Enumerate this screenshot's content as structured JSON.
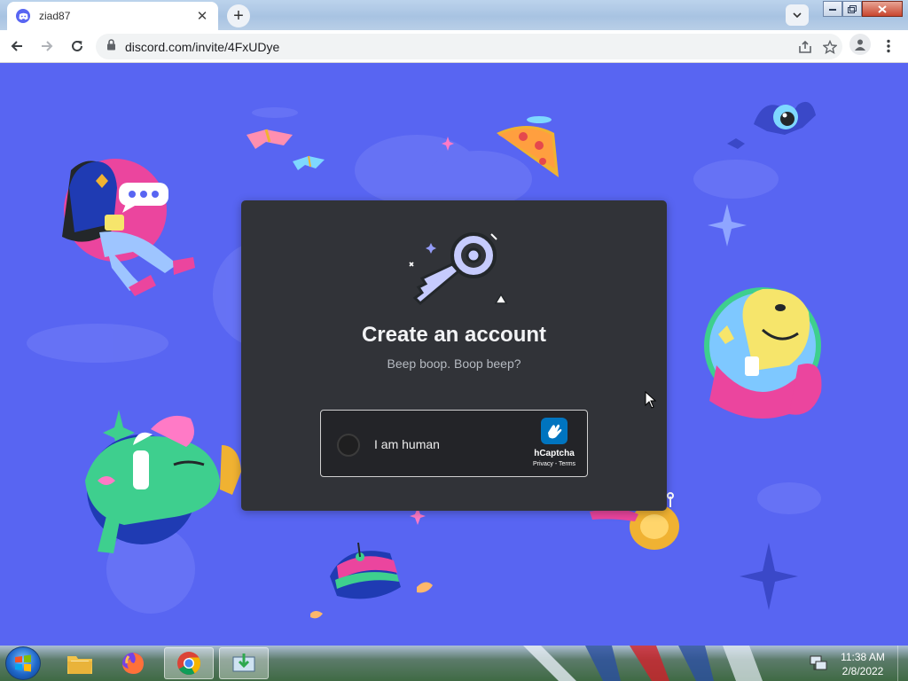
{
  "browser": {
    "tab": {
      "title": "ziad87",
      "close_glyph": "✕",
      "favicon": "discord-icon"
    },
    "new_tab_glyph": "+",
    "address": {
      "url": "discord.com/invite/4FxUDye",
      "lock_icon": "lock-icon"
    },
    "window_controls": [
      "minimize",
      "maximize",
      "close"
    ]
  },
  "page": {
    "background_color": "#5865f2",
    "modal": {
      "title": "Create an account",
      "subtitle": "Beep boop. Boop beep?",
      "background_color": "#313338"
    },
    "captcha": {
      "label": "I am human",
      "brand": "hCaptcha",
      "links": "Privacy - Terms"
    }
  },
  "taskbar": {
    "items": [
      "start-button",
      "explorer-icon",
      "firefox-icon",
      "chrome-icon",
      "download-app-icon"
    ],
    "active_item": "chrome-icon",
    "clock": {
      "time": "11:38 AM",
      "date": "2/8/2022"
    }
  }
}
